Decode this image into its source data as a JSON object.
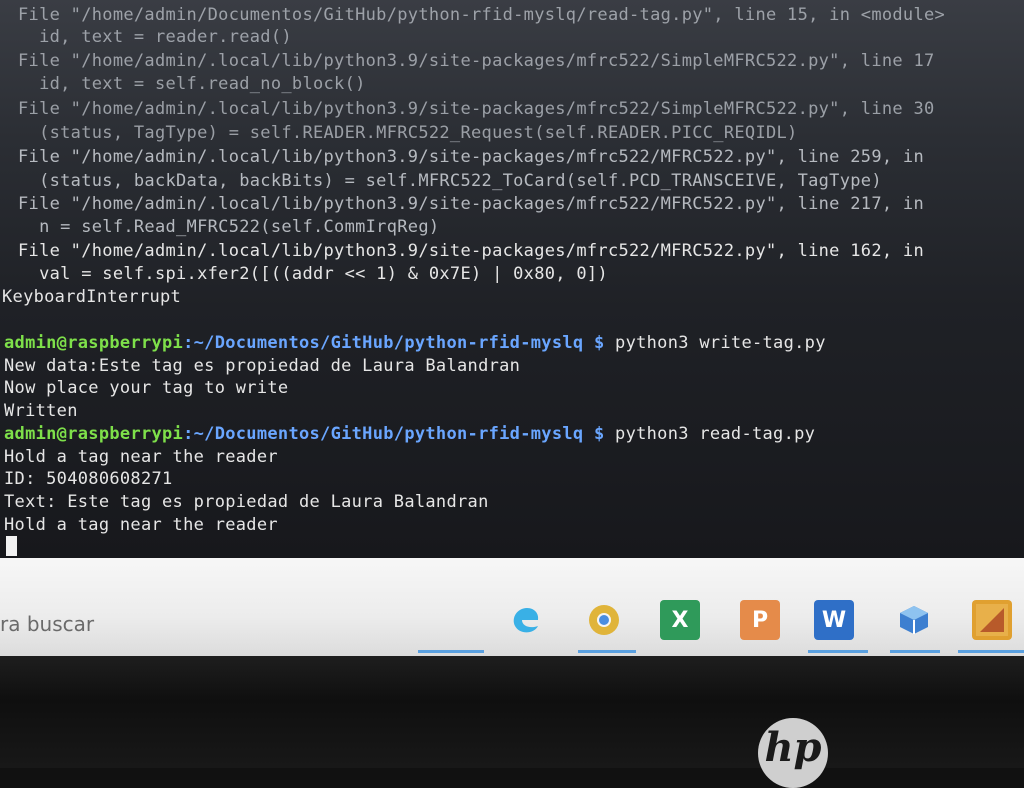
{
  "terminal": {
    "traceback": [
      "File \"/home/admin/Documentos/GitHub/python-rfid-myslq/read-tag.py\", line 15, in <module>",
      "  id, text = reader.read()",
      "File \"/home/admin/.local/lib/python3.9/site-packages/mfrc522/SimpleMFRC522.py\", line 17",
      "  id, text = self.read_no_block()",
      "File \"/home/admin/.local/lib/python3.9/site-packages/mfrc522/SimpleMFRC522.py\", line 30",
      "  (status, TagType) = self.READER.MFRC522_Request(self.READER.PICC_REQIDL)",
      "File \"/home/admin/.local/lib/python3.9/site-packages/mfrc522/MFRC522.py\", line 259, in",
      "  (status, backData, backBits) = self.MFRC522_ToCard(self.PCD_TRANSCEIVE, TagType)",
      "File \"/home/admin/.local/lib/python3.9/site-packages/mfrc522/MFRC522.py\", line 217, in",
      "  n = self.Read_MFRC522(self.CommIrqReg)",
      "File \"/home/admin/.local/lib/python3.9/site-packages/mfrc522/MFRC522.py\", line 162, in",
      "  val = self.spi.xfer2([((addr << 1) & 0x7E) | 0x80, 0])"
    ],
    "interrupt": "KeyboardInterrupt",
    "prompt1": {
      "user": "admin@raspberrypi",
      "path": ":~/Documentos/GitHub/python-rfid-myslq $",
      "command": " python3 write-tag.py"
    },
    "output1": [
      "New data:Este tag es propiedad de Laura Balandran",
      "Now place your tag to write",
      "Written"
    ],
    "prompt2": {
      "user": "admin@raspberrypi",
      "path": ":~/Documentos/GitHub/python-rfid-myslq $",
      "command": " python3 read-tag.py"
    },
    "output2": [
      "Hold a tag near the reader",
      "ID: 504080608271",
      "Text: Este tag es propiedad de Laura Balandran",
      "Hold a tag near the reader"
    ]
  },
  "taskbar": {
    "search_text": "ra buscar",
    "icons": [
      "edge-icon",
      "chrome-icon",
      "excel-icon",
      "powerpoint-icon",
      "word-icon",
      "virtualbox-icon",
      "cmake-icon"
    ]
  },
  "bezel": {
    "logo_text": "hp"
  },
  "colors": {
    "prompt_user": "#7ee04a",
    "prompt_path": "#6aa6ff"
  }
}
